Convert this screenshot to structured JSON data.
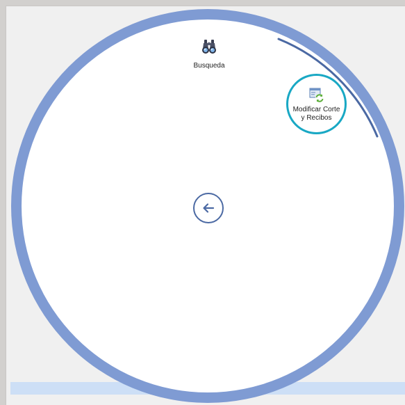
{
  "radial_menu": {
    "items": [
      {
        "label": "Busqueda",
        "icon": "binoculars-icon"
      },
      {
        "label": "Modificar Corte\ny Recibos",
        "icon": "refresh-document-icon",
        "selected": true
      }
    ],
    "back_icon": "back-arrow-icon"
  },
  "colors": {
    "ring": "#7f9bd3",
    "selection": "#19a8c4",
    "arc": "#4b69a3",
    "status_band": "#cddff6"
  }
}
